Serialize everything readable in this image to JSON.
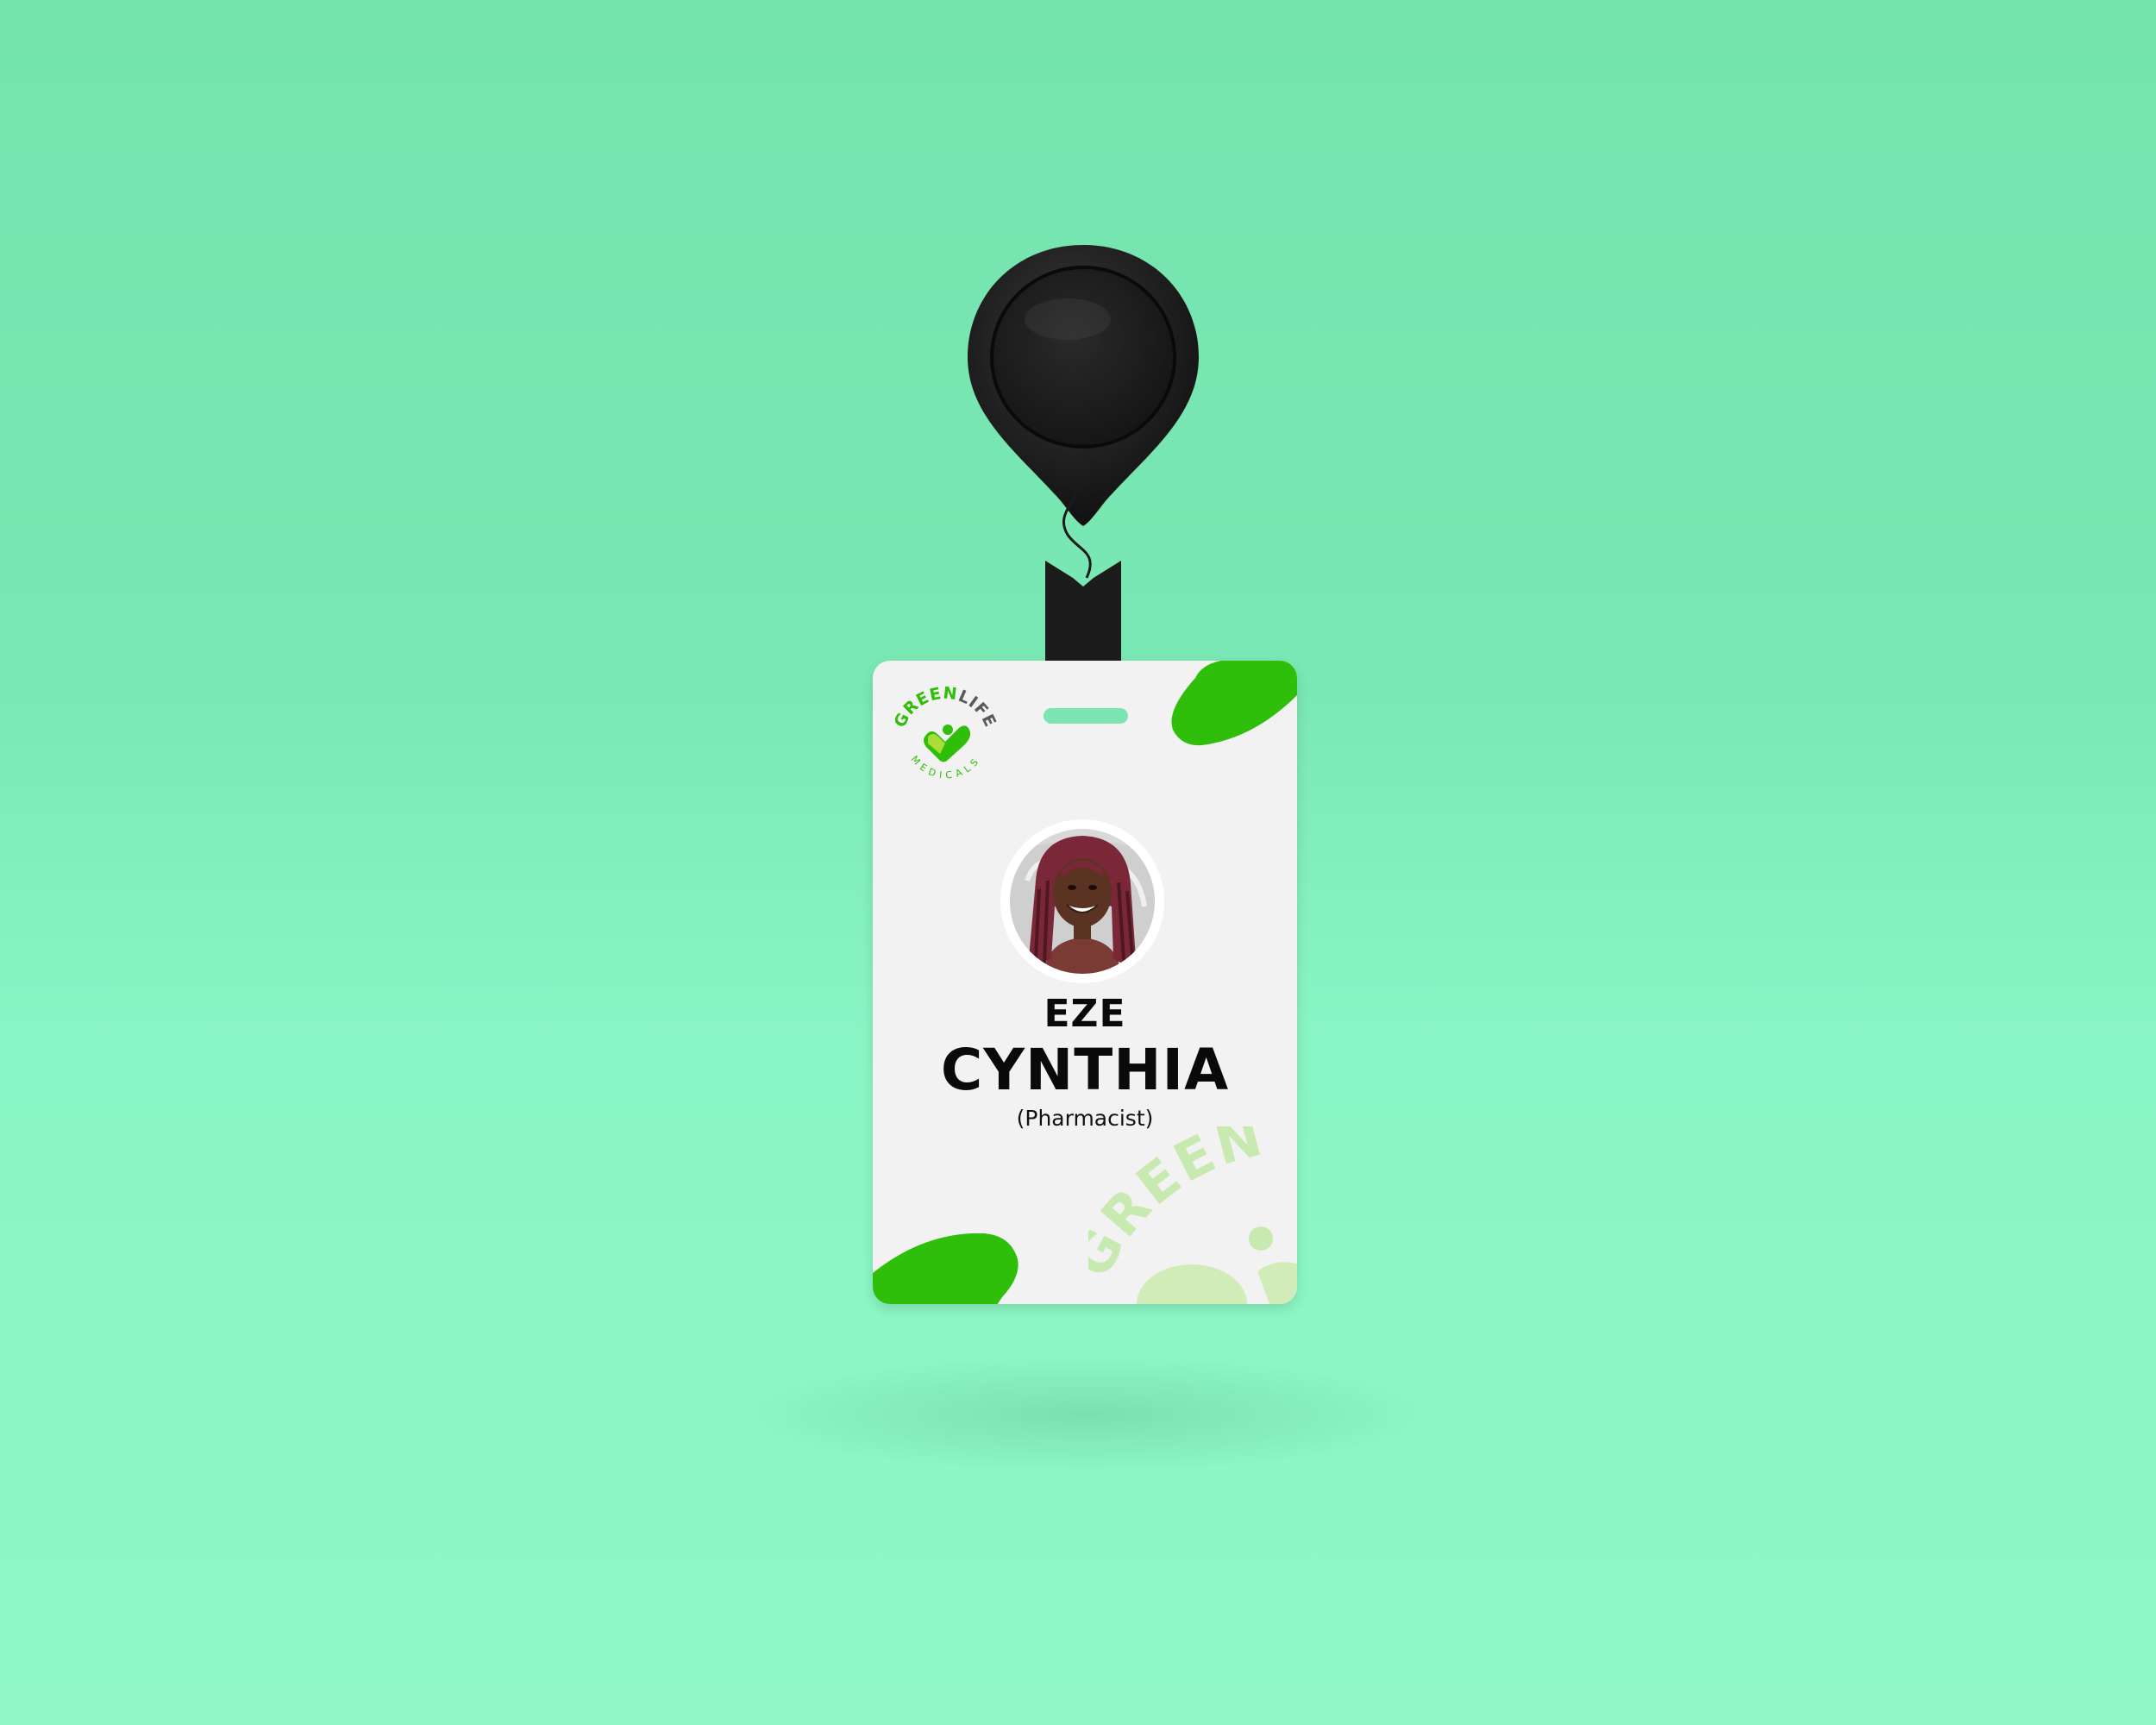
{
  "colors": {
    "background": "#7ae8b4",
    "card": "#f2f2f2",
    "accent_green": "#2fbf0a",
    "light_green": "#c8eab0",
    "reel": "#1e1e1e",
    "text": "#0a0a0a"
  },
  "badge": {
    "logo": {
      "brand_top_green": "GREEN",
      "brand_top_gray": "LIFE",
      "brand_bottom": "MEDICALS",
      "icon": "heart-check-icon"
    },
    "name": {
      "surname": "EZE",
      "first_name": "CYNTHIA"
    },
    "role": "(Pharmacist)",
    "watermark_text": "GREEN",
    "photo": "avatar-photo"
  },
  "holder": {
    "reel": "badge-reel",
    "clip": "badge-clip"
  }
}
